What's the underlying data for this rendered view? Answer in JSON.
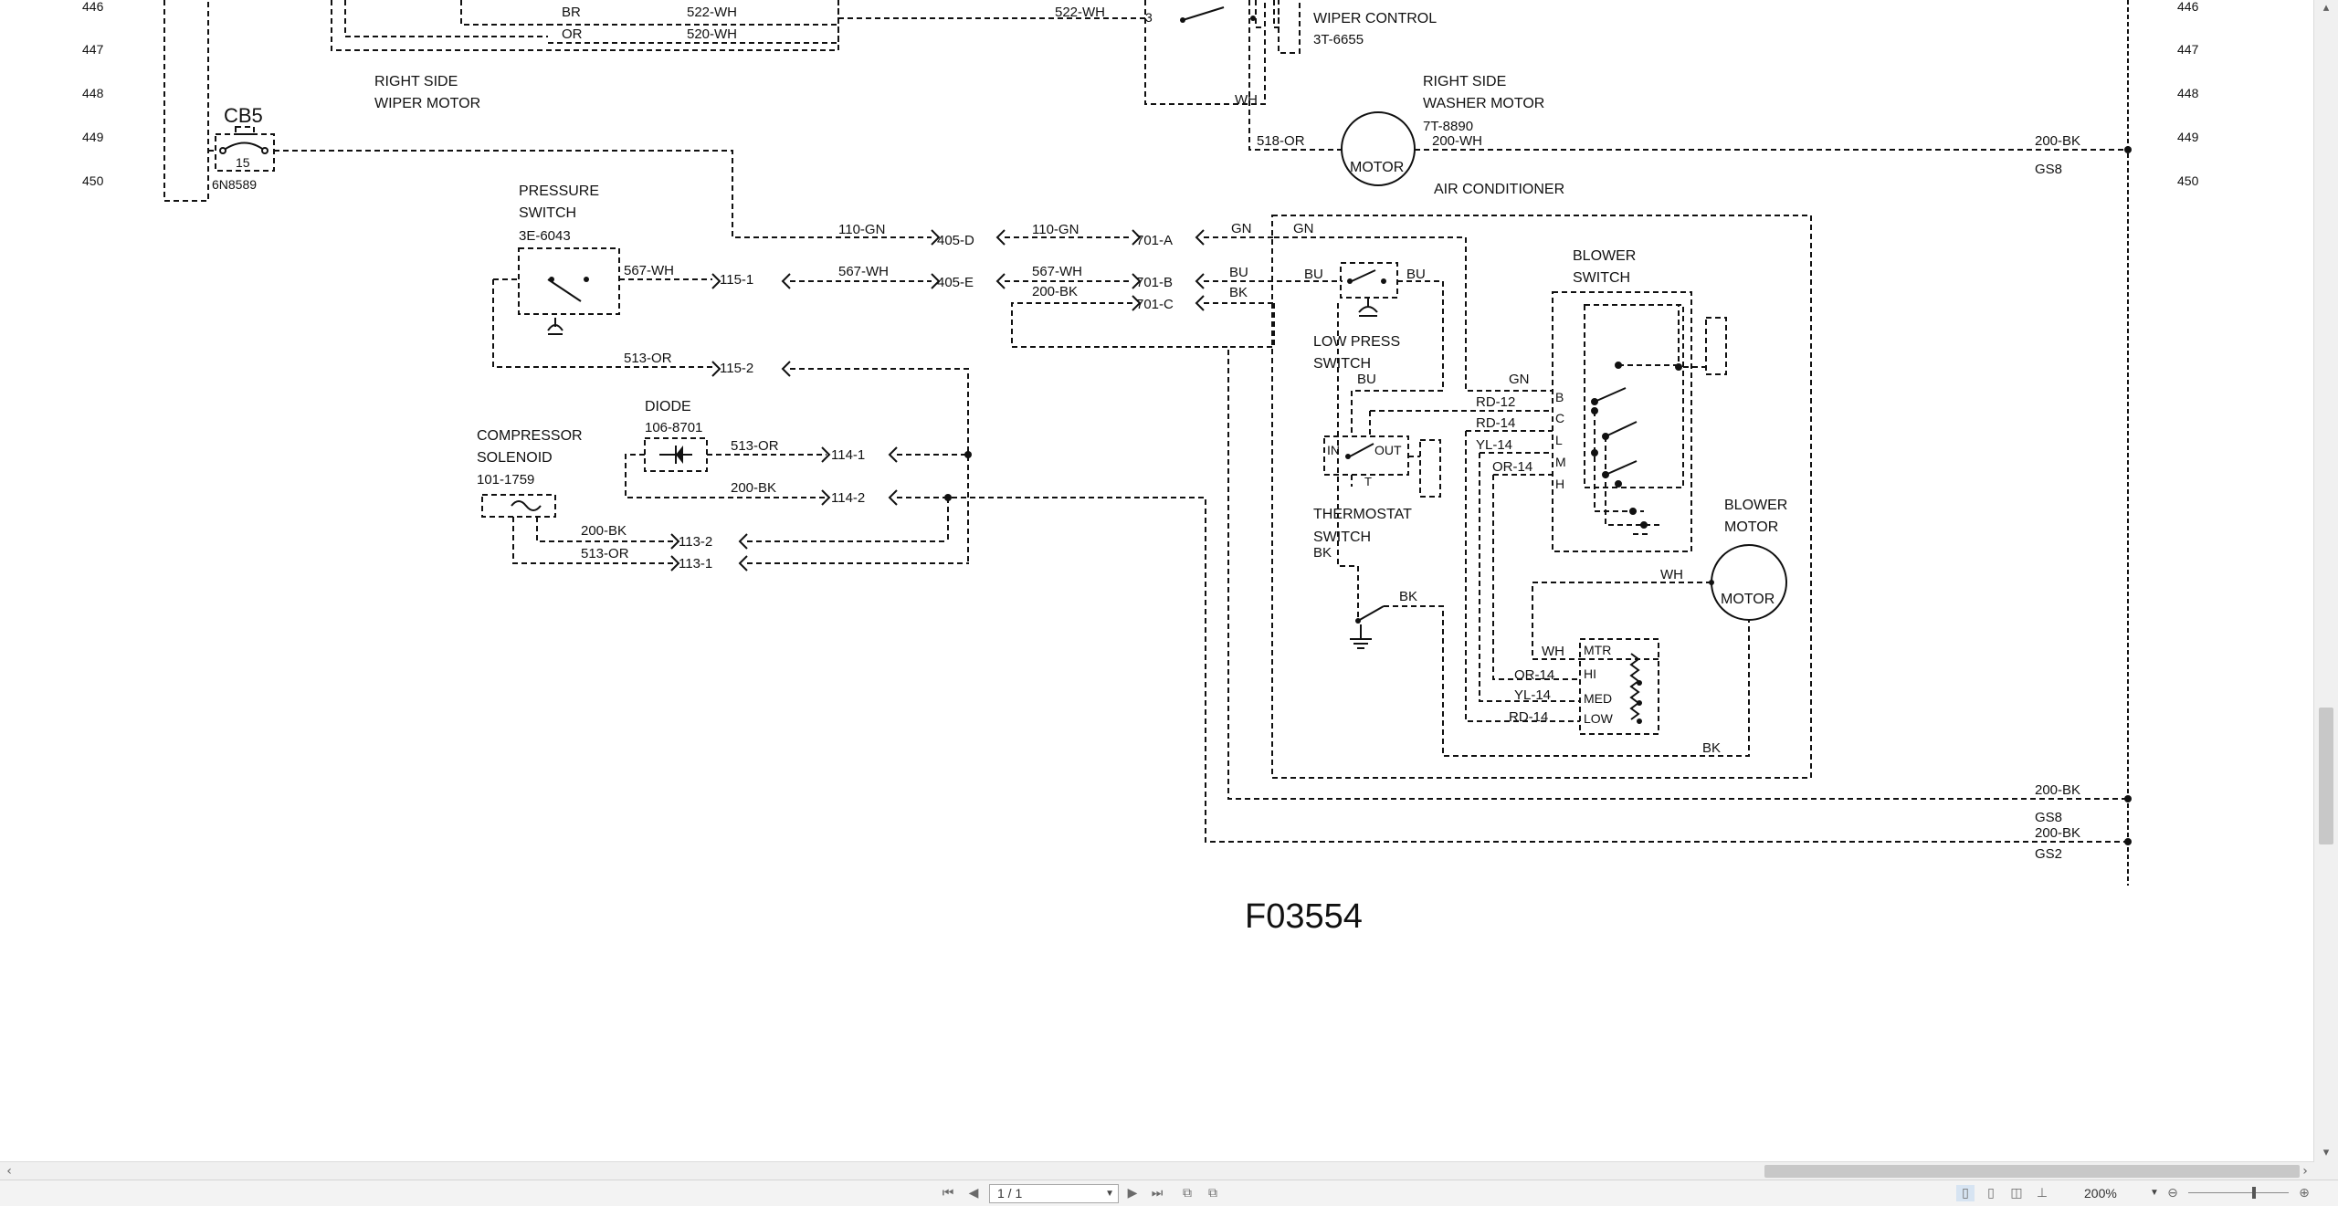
{
  "drawing": {
    "row_numbers": [
      "446",
      "447",
      "448",
      "449",
      "450"
    ],
    "figure_id": "F03554",
    "labels": {
      "cb5": "CB5",
      "cb5_rating": "15",
      "cb5_part": "6N8589",
      "rs_wiper_1": "RIGHT SIDE",
      "rs_wiper_2": "WIPER MOTOR",
      "wiper_control": "WIPER CONTROL",
      "wiper_control_part": "3T-6655",
      "rs_washer_1": "RIGHT SIDE",
      "rs_washer_2": "WASHER MOTOR",
      "rs_washer_part": "7T-8890",
      "motor": "MOTOR",
      "air_conditioner": "AIR CONDITIONER",
      "pressure_1": "PRESSURE",
      "pressure_2": "SWITCH",
      "pressure_part": "3E-6043",
      "diode": "DIODE",
      "diode_part": "106-8701",
      "compressor_1": "COMPRESSOR",
      "compressor_2": "SOLENOID",
      "compressor_part": "101-1759",
      "low_press_1": "LOW PRESS",
      "low_press_2": "SWITCH",
      "thermostat_1": "THERMOSTAT",
      "thermostat_2": "SWITCH",
      "blower_switch_1": "BLOWER",
      "blower_switch_2": "SWITCH",
      "blower_motor_1": "BLOWER",
      "blower_motor_2": "MOTOR",
      "in": "IN",
      "out": "OUT",
      "t": "T",
      "gs8_a": "GS8",
      "gs8_b": "GS8",
      "gs2": "GS2",
      "sw_b": "B",
      "sw_c": "C",
      "sw_l": "L",
      "sw_m": "M",
      "sw_h": "H",
      "mtr": "MTR",
      "hi": "HI",
      "med": "MED",
      "low": "LOW"
    },
    "connectors": {
      "c405d": "405-D",
      "c405e": "405-E",
      "c701a": "701-A",
      "c701b": "701-B",
      "c701c": "701-C",
      "c115_1": "115-1",
      "c115_2": "115-2",
      "c114_1": "114-1",
      "c114_2": "114-2",
      "c113_2": "113-2",
      "c113_1": "113-1",
      "c3": "3"
    },
    "wires": {
      "br": "BR",
      "or": "OR",
      "w522a": "522-WH",
      "w520": "520-WH",
      "w522b": "522-WH",
      "wh_top": "WH",
      "w518": "518-OR",
      "w200wh": "200-WH",
      "w200bk_a": "200-BK",
      "w110a": "110-GN",
      "w110b": "110-GN",
      "gn1": "GN",
      "gn2": "GN",
      "w567a": "567-WH",
      "w567b": "567-WH",
      "w567c": "567-WH",
      "bu1": "BU",
      "bu2": "BU",
      "bu3": "BU",
      "bu4": "BU",
      "w200bk_c": "200-BK",
      "bk1": "BK",
      "w513a": "513-OR",
      "w513b": "513-OR",
      "w200bk_d": "200-BK",
      "w200bk_e": "200-BK",
      "w513c": "513-OR",
      "gn3": "GN",
      "rd12": "RD-12",
      "rd14a": "RD-14",
      "yl14a": "YL-14",
      "or14a": "OR-14",
      "bk2": "BK",
      "bk3": "BK",
      "wh1": "WH",
      "wh2": "WH",
      "or14b": "OR-14",
      "yl14b": "YL-14",
      "rd14b": "RD-14",
      "bk4": "BK",
      "w200bk_f": "200-BK",
      "w200bk_g": "200-BK"
    }
  },
  "statusbar": {
    "page": "1 / 1",
    "zoom": "200%",
    "zoom_out": "⊖",
    "zoom_in": "⊕"
  }
}
